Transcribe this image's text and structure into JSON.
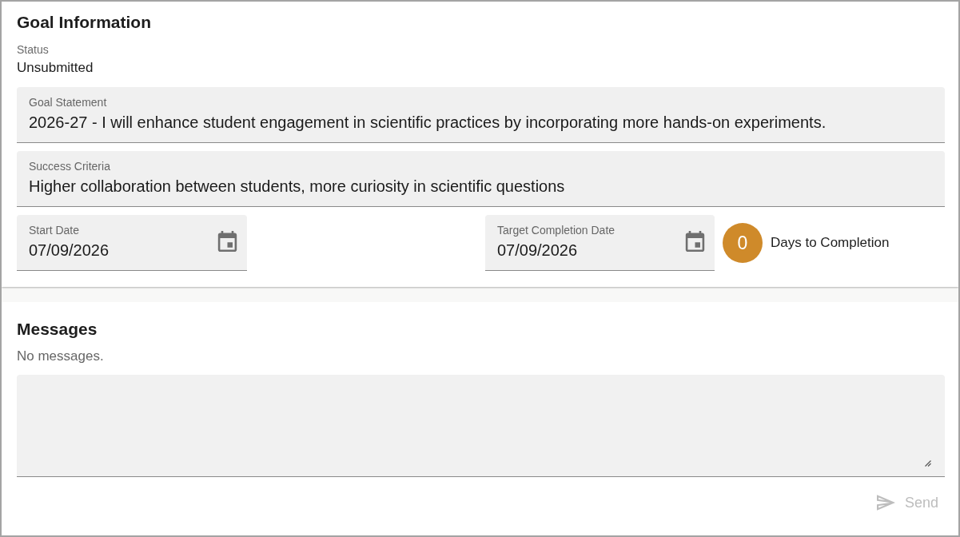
{
  "goal_information": {
    "title": "Goal Information",
    "status": {
      "label": "Status",
      "value": "Unsubmitted"
    },
    "fields": [
      {
        "label": "Goal Statement",
        "value": "2026-27 - I will enhance student engagement in scientific practices by incorporating more hands-on experiments."
      },
      {
        "label": "Success Criteria",
        "value": "Higher collaboration between students, more curiosity in scientific questions"
      }
    ],
    "dates": [
      {
        "label": "Start Date",
        "value": "07/09/2026"
      },
      {
        "label": "Target Completion Date",
        "value": "07/09/2026"
      }
    ],
    "days_to_completion": {
      "count": "0",
      "label": "Days to Completion"
    }
  },
  "messages": {
    "title": "Messages",
    "empty_text": "No messages.",
    "send_button": {
      "label": "Send",
      "disabled": true
    }
  }
}
